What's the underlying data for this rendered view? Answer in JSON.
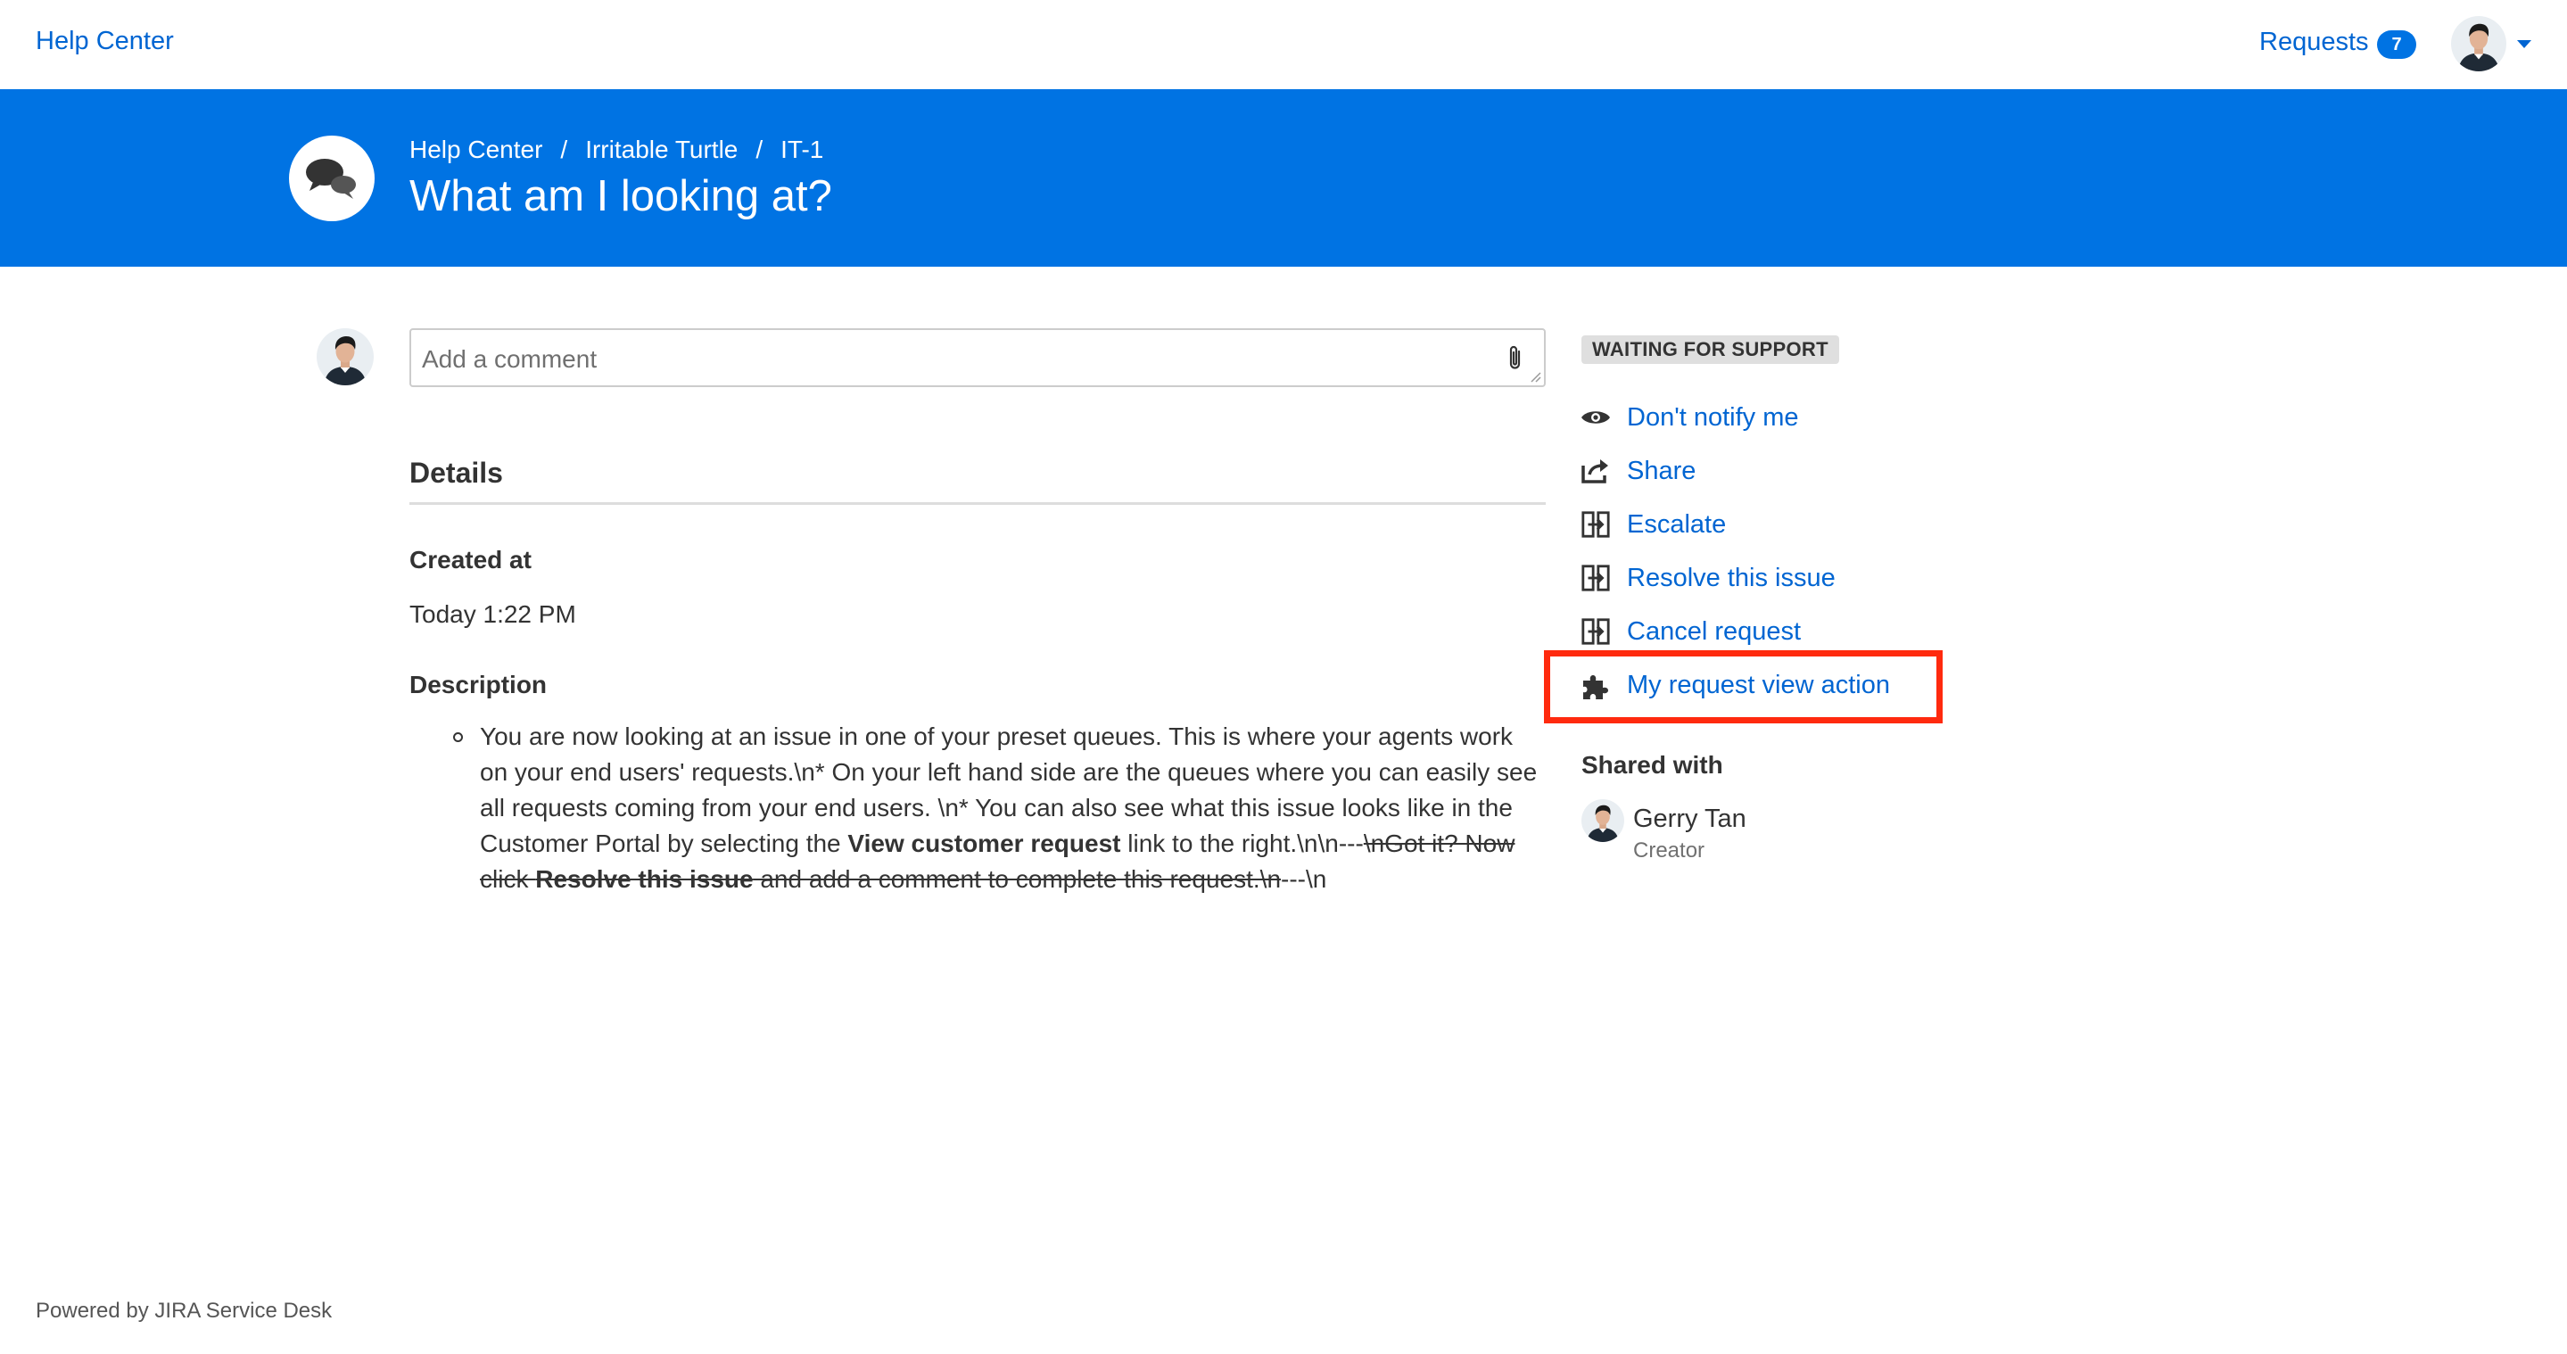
{
  "topbar": {
    "home_label": "Help Center",
    "requests_label": "Requests",
    "requests_count": "7"
  },
  "header": {
    "breadcrumb": [
      "Help Center",
      "Irritable Turtle",
      "IT-1"
    ],
    "breadcrumb_separator": "/",
    "title": "What am I looking at?"
  },
  "comment": {
    "placeholder": "Add a comment"
  },
  "details": {
    "heading": "Details",
    "created_label": "Created at",
    "created_value": "Today 1:22 PM",
    "description_label": "Description",
    "description": {
      "part1": "You are now looking at an issue in one of your preset queues. This is where your agents work on your end users' requests.\\n* On your left hand side are the queues where you can easily see all requests coming from your end users. \\n* You can also see what this issue looks like in the Customer Portal by selecting the ",
      "bold1": "View customer request",
      "part2": " link to the right.\\n\\n---",
      "strike1": "\\nGot it? Now click ",
      "strike_bold": "Resolve this issue",
      "strike2": " and add a comment to complete this request.\\n",
      "part3": "---\\n"
    }
  },
  "sidebar": {
    "status": "WAITING FOR SUPPORT",
    "actions": [
      {
        "label": "Don't notify me",
        "icon": "eye-icon"
      },
      {
        "label": "Share",
        "icon": "share-icon"
      },
      {
        "label": "Escalate",
        "icon": "transition-icon"
      },
      {
        "label": "Resolve this issue",
        "icon": "transition-icon"
      },
      {
        "label": "Cancel request",
        "icon": "transition-icon"
      },
      {
        "label": "My request view action",
        "icon": "puzzle-icon"
      }
    ],
    "shared_heading": "Shared with",
    "shared_people": [
      {
        "name": "Gerry Tan",
        "role": "Creator"
      }
    ]
  },
  "footer": {
    "text": "Powered by JIRA Service Desk"
  },
  "colors": {
    "brand_blue": "#0073e3",
    "link_blue": "#0065d2",
    "highlight_red": "#ff2a0e",
    "lozenge_grey": "#dfdfdf"
  }
}
